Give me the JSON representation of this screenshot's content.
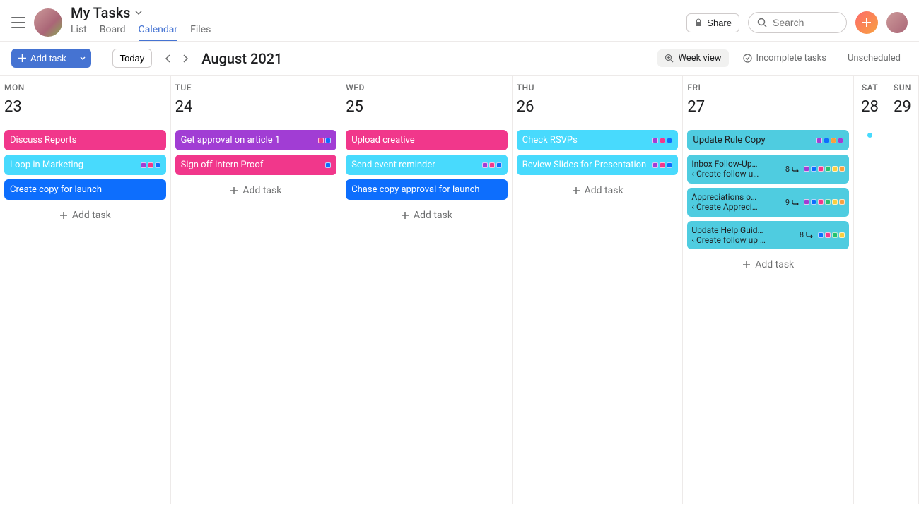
{
  "header": {
    "page_title": "My Tasks",
    "tabs": [
      "List",
      "Board",
      "Calendar",
      "Files"
    ],
    "active_tab": "Calendar",
    "share_label": "Share",
    "search_placeholder": "Search"
  },
  "toolbar": {
    "add_task_label": "Add task",
    "today_label": "Today",
    "month_label": "August 2021",
    "view_label": "Week view",
    "filter_label": "Incomplete tasks",
    "unscheduled_label": "Unscheduled"
  },
  "days": [
    {
      "name": "MON",
      "num": "23",
      "tasks": [
        {
          "title": "Discuss Reports",
          "color": "pink",
          "dots": []
        },
        {
          "title": "Loop in Marketing",
          "color": "cyan-blue",
          "dots": [
            "#a13dd4",
            "#f1378b",
            "#0d6efd"
          ]
        },
        {
          "title": "Create copy for launch",
          "color": "blue-dark",
          "dots": []
        }
      ],
      "add_label": "Add task"
    },
    {
      "name": "TUE",
      "num": "24",
      "tasks": [
        {
          "title": "Get approval on article 1",
          "color": "purple",
          "dots": [
            "#f1378b",
            "#0d6efd"
          ]
        },
        {
          "title": "Sign off Intern Proof",
          "color": "pink",
          "dots": [
            "#0d6efd"
          ]
        }
      ],
      "add_label": "Add task"
    },
    {
      "name": "WED",
      "num": "25",
      "tasks": [
        {
          "title": "Upload creative",
          "color": "pink",
          "dots": []
        },
        {
          "title": "Send event reminder",
          "color": "cyan-blue",
          "dots": [
            "#a13dd4",
            "#f1378b",
            "#0d6efd"
          ]
        },
        {
          "title": "Chase copy approval for launch",
          "color": "blue-dark",
          "dots": []
        }
      ],
      "add_label": "Add task"
    },
    {
      "name": "THU",
      "num": "26",
      "tasks": [
        {
          "title": "Check RSVPs",
          "color": "cyan-blue",
          "dots": [
            "#a13dd4",
            "#f1378b",
            "#0d6efd"
          ]
        },
        {
          "title": "Review Slides for Presentation",
          "color": "cyan-blue",
          "dots": [
            "#a13dd4",
            "#f1378b",
            "#0d6efd"
          ],
          "multiline": true
        }
      ],
      "add_label": "Add task"
    },
    {
      "name": "FRI",
      "num": "27",
      "tasks": [
        {
          "title": "Update Rule Copy",
          "color": "light-cyan",
          "dots": [
            "#a13dd4",
            "#0d6efd",
            "#f8a13f",
            "#a13dd4"
          ],
          "dark": true
        },
        {
          "title": "Inbox Follow-Up…",
          "sub": "‹ Create follow u…",
          "color": "light-cyan",
          "count": "8",
          "dots": [
            "#a13dd4",
            "#0d6efd",
            "#f1378b",
            "#25c16f",
            "#f8ce3f",
            "#f8a13f"
          ],
          "dark": true,
          "subtask": true
        },
        {
          "title": "Appreciations o…",
          "sub": "‹ Create Appreci…",
          "color": "light-cyan",
          "count": "9",
          "dots": [
            "#a13dd4",
            "#0d6efd",
            "#f1378b",
            "#25c16f",
            "#f8ce3f",
            "#f8a13f"
          ],
          "dark": true,
          "subtask": true
        },
        {
          "title": "Update Help Guid…",
          "sub": "‹ Create follow up …",
          "color": "light-cyan",
          "count": "8",
          "dots": [
            "#0d6efd",
            "#f1378b",
            "#25c16f",
            "#f8ce3f"
          ],
          "dark": true,
          "subtask": true
        }
      ],
      "add_label": "Add task"
    },
    {
      "name": "SAT",
      "num": "28",
      "narrow": true,
      "indicator": true
    },
    {
      "name": "SUN",
      "num": "29",
      "narrow": true
    }
  ]
}
